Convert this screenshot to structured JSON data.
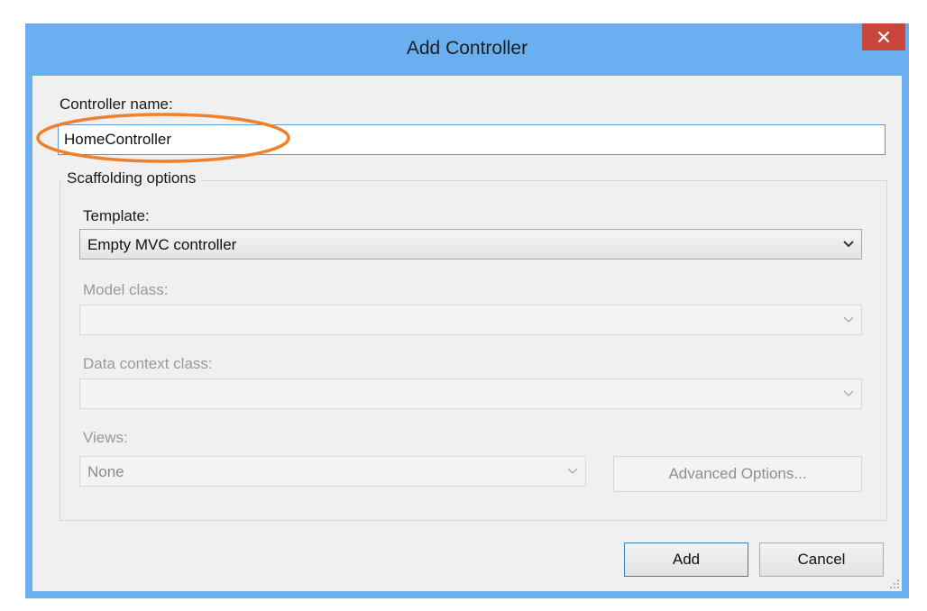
{
  "dialog": {
    "title": "Add Controller",
    "close_icon": "close-icon",
    "accent_color": "#6aaff0",
    "close_color": "#c9463d"
  },
  "controller_name": {
    "label": "Controller name:",
    "value": "HomeController",
    "highlight_color": "#f0812a"
  },
  "scaffolding": {
    "group_title": "Scaffolding options",
    "template": {
      "label": "Template:",
      "selected": "Empty MVC controller"
    },
    "model_class": {
      "label": "Model class:",
      "selected": ""
    },
    "data_context_class": {
      "label": "Data context class:",
      "selected": ""
    },
    "views": {
      "label": "Views:",
      "selected": "None"
    },
    "advanced_options_label": "Advanced Options..."
  },
  "buttons": {
    "add_label": "Add",
    "cancel_label": "Cancel"
  }
}
